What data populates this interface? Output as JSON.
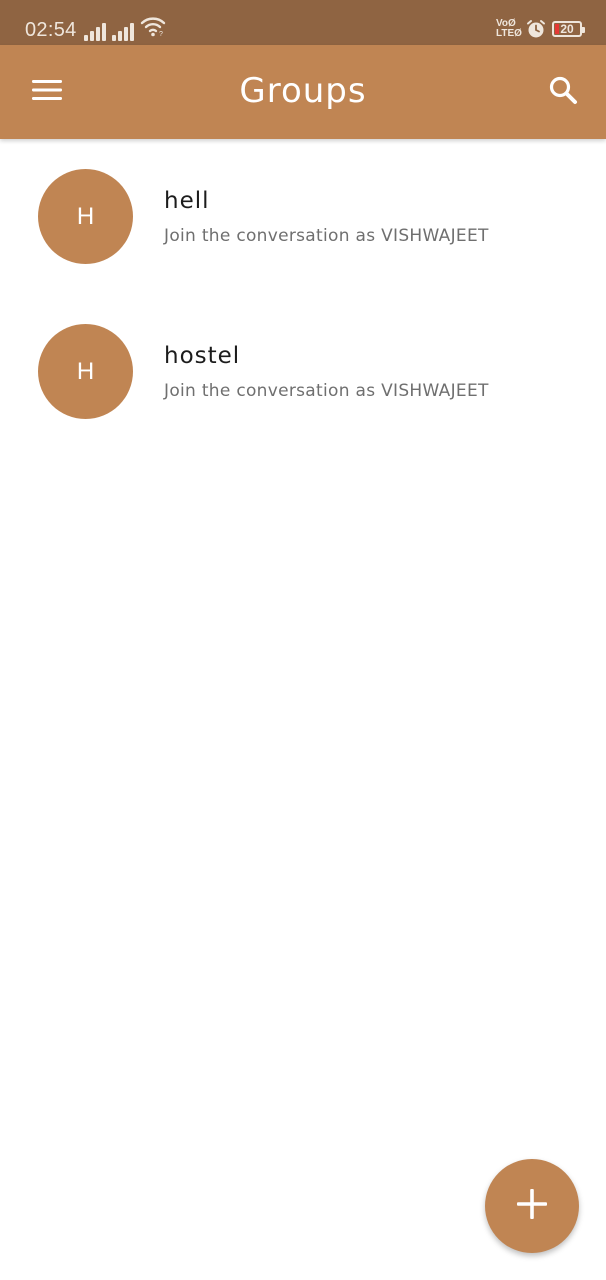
{
  "status_bar": {
    "time": "02:54",
    "volte_top": "VoØ",
    "volte_bottom": "LTEØ",
    "battery_level": "20",
    "icons": [
      "signal-icon",
      "signal-icon",
      "wifi-icon",
      "volte-icon",
      "alarm-icon",
      "battery-icon"
    ]
  },
  "app_bar": {
    "title": "Groups",
    "menu_icon": "hamburger-menu-icon",
    "search_icon": "search-icon",
    "background": "#c08553"
  },
  "groups": [
    {
      "avatar_letter": "H",
      "name": "hell",
      "subtitle": "Join the conversation as VISHWAJEET"
    },
    {
      "avatar_letter": "H",
      "name": "hostel",
      "subtitle": "Join the conversation as VISHWAJEET"
    }
  ],
  "fab": {
    "icon": "plus-icon",
    "background": "#c08553"
  },
  "colors": {
    "status_bar": "#8f6442",
    "accent": "#c08553",
    "battery_low": "#e53935"
  }
}
